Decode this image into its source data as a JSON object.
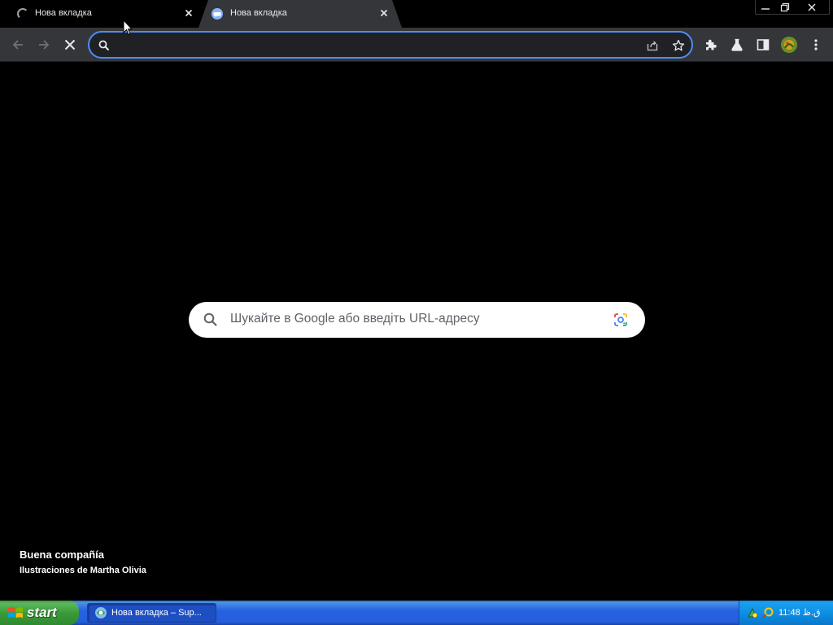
{
  "tabs": [
    {
      "label": "Нова вкладка",
      "state": "loading"
    },
    {
      "label": "Нова вкладка",
      "state": "active"
    }
  ],
  "omnibox": {
    "value": "",
    "placeholder": ""
  },
  "ntp": {
    "search_placeholder": "Шукайте в Google або введіть URL-адресу",
    "attribution_title": "Buena compañía",
    "attribution_subtitle": "Ilustraciones de Martha Olivia"
  },
  "taskbar": {
    "start_label": "start",
    "task_label": "Нова вкладка – Sup...",
    "clock": "11:48 ق.ظ"
  },
  "icons": {
    "tab1": "loading-spinner-icon",
    "tab2": "chat-bubble-icon",
    "toolbar": [
      "back-icon",
      "forward-icon",
      "stop-icon",
      "share-icon",
      "star-icon",
      "extensions-icon",
      "labs-icon",
      "side-panel-icon",
      "profile-avatar",
      "menu-icon"
    ]
  },
  "colors": {
    "accent": "#4d8df5",
    "toolbar": "#35363a",
    "page_background": "#000000",
    "taskbar": "#245edb",
    "start_button": "#3a9a3a"
  }
}
